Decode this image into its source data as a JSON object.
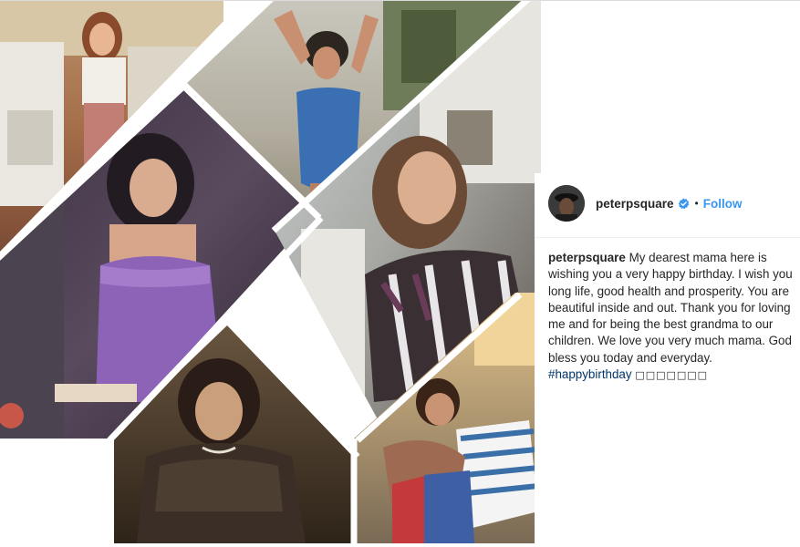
{
  "post": {
    "username": "peterpsquare",
    "separator": "•",
    "follow_label": "Follow",
    "caption": {
      "username": "peterpsquare",
      "text": "My dearest mama here is wishing you a very happy birthday. I wish you long life, good health and prosperity. You are beautiful inside and out. Thank you for loving me and for being the best grandma to our children. We love you very much mama. God bless you today and everyday.",
      "hashtag": "#happybirthday",
      "emoji": "□□□□□□□"
    }
  },
  "icons": {
    "verified": "verified-badge-icon",
    "avatar": "profile-avatar"
  },
  "colors": {
    "link_blue": "#3897f0",
    "hashtag_navy": "#003569",
    "text": "#262626",
    "verified_blue": "#3897f0"
  }
}
